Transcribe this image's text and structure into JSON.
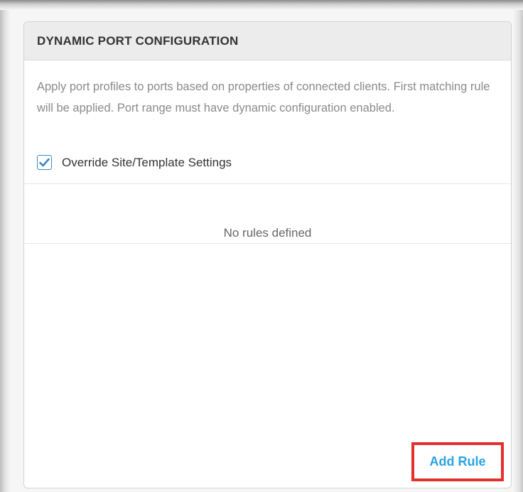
{
  "panel": {
    "title": "DYNAMIC PORT CONFIGURATION",
    "description": "Apply port profiles to ports based on properties of connected clients. First matching rule will be applied. Port range must have dynamic configuration enabled.",
    "override_checkbox": {
      "label": "Override Site/Template Settings",
      "checked": true,
      "check_color": "#3a87c7"
    },
    "rules": [],
    "empty_message": "No rules defined",
    "add_rule_label": "Add Rule",
    "add_rule_color": "#29a3e4",
    "highlight_color": "#e4302b"
  }
}
